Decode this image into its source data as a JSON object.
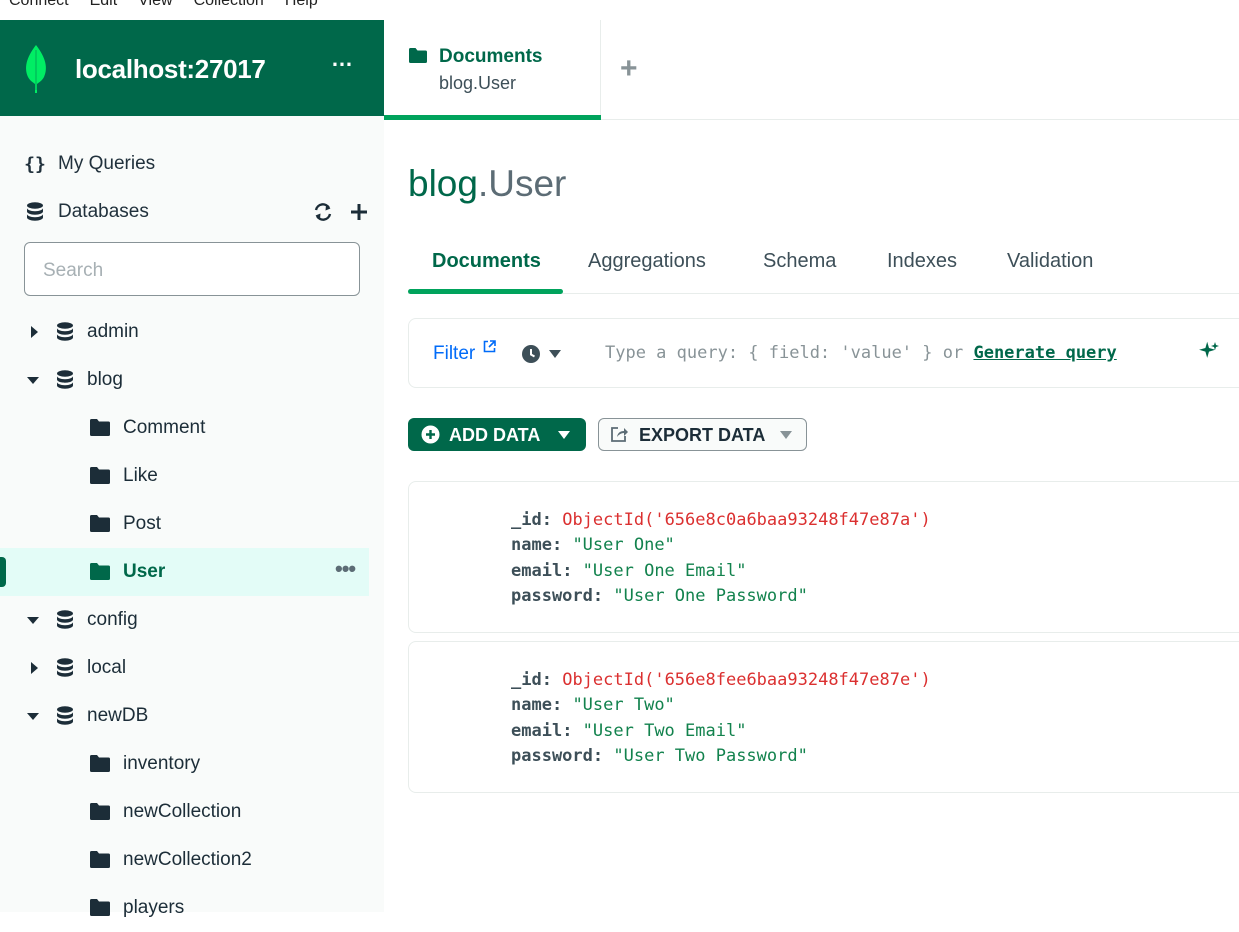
{
  "menubar": [
    "Connect",
    "Edit",
    "View",
    "Collection",
    "Help"
  ],
  "connection": {
    "title": "localhost:27017",
    "more_label": "…"
  },
  "sidebar": {
    "my_queries": "My Queries",
    "databases": "Databases",
    "search_placeholder": "Search",
    "tree": [
      {
        "label": "admin",
        "type": "database",
        "expanded": false
      },
      {
        "label": "blog",
        "type": "database",
        "expanded": true
      },
      {
        "label": "Comment",
        "type": "collection"
      },
      {
        "label": "Like",
        "type": "collection"
      },
      {
        "label": "Post",
        "type": "collection"
      },
      {
        "label": "User",
        "type": "collection",
        "selected": true
      },
      {
        "label": "config",
        "type": "database",
        "expanded": true
      },
      {
        "label": "local",
        "type": "database",
        "expanded": false
      },
      {
        "label": "newDB",
        "type": "database",
        "expanded": true
      },
      {
        "label": "inventory",
        "type": "collection"
      },
      {
        "label": "newCollection",
        "type": "collection"
      },
      {
        "label": "newCollection2",
        "type": "collection"
      },
      {
        "label": "players",
        "type": "collection"
      }
    ]
  },
  "workspace_tab": {
    "title": "Documents",
    "subtitle": "blog.User"
  },
  "namespace": {
    "db": "blog",
    "separator": ".",
    "collection": "User"
  },
  "subtabs": [
    "Documents",
    "Aggregations",
    "Schema",
    "Indexes",
    "Validation"
  ],
  "query_bar": {
    "filter_label": "Filter",
    "placeholder_prefix": "Type a query: { field: 'value' } or ",
    "generate_label": "Generate query"
  },
  "buttons": {
    "add_data": "ADD DATA",
    "export_data": "EXPORT DATA"
  },
  "documents": [
    {
      "fields": [
        {
          "key": "_id",
          "prefix": "ObjectId('",
          "value": "656e8c0a6baa93248f47e87a",
          "suffix": "')",
          "kind": "oid"
        },
        {
          "key": "name",
          "value": "\"User One\"",
          "kind": "str"
        },
        {
          "key": "email",
          "value": "\"User One Email\"",
          "kind": "str"
        },
        {
          "key": "password",
          "value": "\"User One Password\"",
          "kind": "str"
        }
      ]
    },
    {
      "fields": [
        {
          "key": "_id",
          "prefix": "ObjectId('",
          "value": "656e8fee6baa93248f47e87e",
          "suffix": "')",
          "kind": "oid"
        },
        {
          "key": "name",
          "value": "\"User Two\"",
          "kind": "str"
        },
        {
          "key": "email",
          "value": "\"User Two Email\"",
          "kind": "str"
        },
        {
          "key": "password",
          "value": "\"User Two Password\"",
          "kind": "str"
        }
      ]
    }
  ],
  "colors": {
    "brand_green": "#00684a",
    "accent_green": "#00a35c",
    "link_blue": "#016bf8",
    "oid_red": "#db3030",
    "string_green": "#12824d"
  }
}
